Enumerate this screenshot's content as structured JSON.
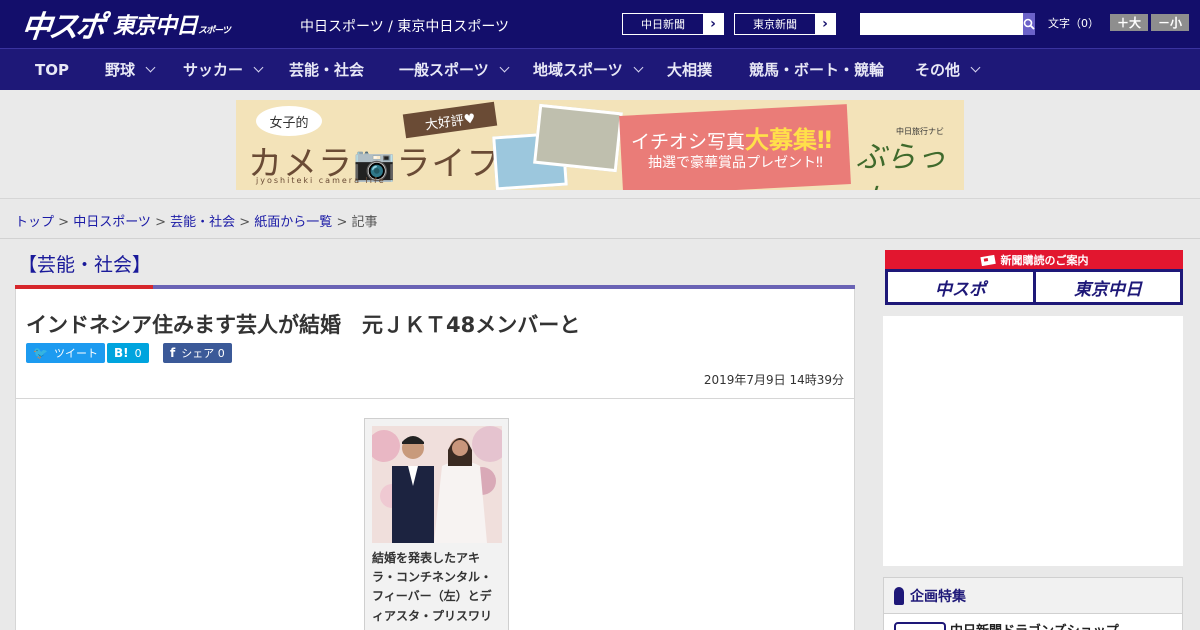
{
  "header": {
    "logo_main": "中スポ",
    "logo_tokyo": "東京中日",
    "logo_tokyo_small": "スポーツ",
    "site_links": "中日スポーツ / 東京中日スポーツ",
    "paper_buttons": [
      "中日新聞",
      "東京新聞"
    ],
    "search_placeholder": "",
    "font_size_label": "文字（0）",
    "font_larger": "＋大",
    "font_smaller": "－小"
  },
  "nav": {
    "items": [
      "TOP",
      "野球",
      "サッカー",
      "芸能・社会",
      "一般スポーツ",
      "地域スポーツ",
      "大相撲",
      "競馬・ボート・競輪",
      "その他"
    ]
  },
  "banner": {
    "bubble": "女子的",
    "title": "カメラ📷ライフ",
    "subtitle": "jyoshiteki camera life",
    "tag": "大好評♥",
    "headline_prefix": "イチオシ写真",
    "headline_emph": "大募集‼",
    "prize": "抽選で豪華賞品プレゼント‼",
    "navi": "中日旅行ナビ",
    "brand": "ぶらっ人"
  },
  "breadcrumb": {
    "items": [
      "トップ",
      "中日スポーツ",
      "芸能・社会",
      "紙面から一覧"
    ],
    "current": "記事",
    "separator": " > "
  },
  "article": {
    "category": "【芸能・社会】",
    "headline": "インドネシア住みます芸人が結婚　元ＪＫＴ48メンバーと",
    "share": {
      "tweet": "ツイート",
      "hatena_count": "0",
      "facebook": "シェア",
      "facebook_count": "0"
    },
    "date": "2019年7月9日 14時39分",
    "photo_caption": "結婚を発表したアキラ・コンチネンタル・フィーバー（左）とディアスタ・プリスワリニ"
  },
  "sidebar": {
    "subscribe_title": "新聞購読のご案内",
    "subscribe_buttons": [
      "中スポ",
      "東京中日"
    ],
    "feature_title": "企画特集",
    "feature_item": "中日新聞ドラゴンズショップ"
  },
  "colors": {
    "header_bg": "#130e6b",
    "nav_bg": "#1e1878",
    "accent_red": "#d6262b",
    "link": "#1a1aa6"
  }
}
